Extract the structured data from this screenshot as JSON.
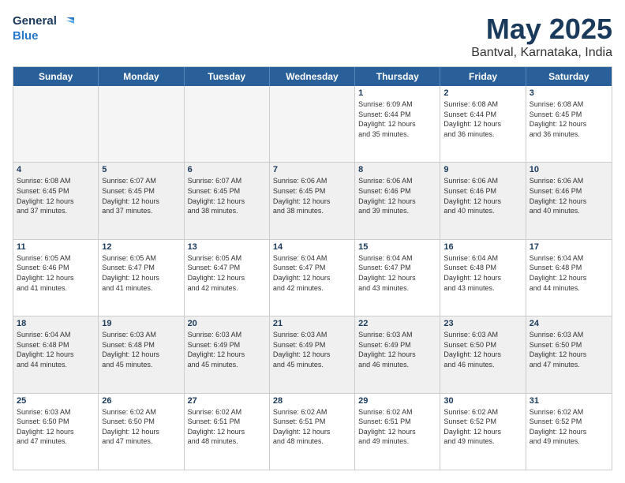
{
  "logo": {
    "line1": "General",
    "line2": "Blue"
  },
  "title": "May 2025",
  "subtitle": "Bantval, Karnataka, India",
  "header_days": [
    "Sunday",
    "Monday",
    "Tuesday",
    "Wednesday",
    "Thursday",
    "Friday",
    "Saturday"
  ],
  "rows": [
    [
      {
        "day": "",
        "info": "",
        "empty": true
      },
      {
        "day": "",
        "info": "",
        "empty": true
      },
      {
        "day": "",
        "info": "",
        "empty": true
      },
      {
        "day": "",
        "info": "",
        "empty": true
      },
      {
        "day": "1",
        "info": "Sunrise: 6:09 AM\nSunset: 6:44 PM\nDaylight: 12 hours\nand 35 minutes."
      },
      {
        "day": "2",
        "info": "Sunrise: 6:08 AM\nSunset: 6:44 PM\nDaylight: 12 hours\nand 36 minutes."
      },
      {
        "day": "3",
        "info": "Sunrise: 6:08 AM\nSunset: 6:45 PM\nDaylight: 12 hours\nand 36 minutes."
      }
    ],
    [
      {
        "day": "4",
        "info": "Sunrise: 6:08 AM\nSunset: 6:45 PM\nDaylight: 12 hours\nand 37 minutes."
      },
      {
        "day": "5",
        "info": "Sunrise: 6:07 AM\nSunset: 6:45 PM\nDaylight: 12 hours\nand 37 minutes."
      },
      {
        "day": "6",
        "info": "Sunrise: 6:07 AM\nSunset: 6:45 PM\nDaylight: 12 hours\nand 38 minutes."
      },
      {
        "day": "7",
        "info": "Sunrise: 6:06 AM\nSunset: 6:45 PM\nDaylight: 12 hours\nand 38 minutes."
      },
      {
        "day": "8",
        "info": "Sunrise: 6:06 AM\nSunset: 6:46 PM\nDaylight: 12 hours\nand 39 minutes."
      },
      {
        "day": "9",
        "info": "Sunrise: 6:06 AM\nSunset: 6:46 PM\nDaylight: 12 hours\nand 40 minutes."
      },
      {
        "day": "10",
        "info": "Sunrise: 6:06 AM\nSunset: 6:46 PM\nDaylight: 12 hours\nand 40 minutes."
      }
    ],
    [
      {
        "day": "11",
        "info": "Sunrise: 6:05 AM\nSunset: 6:46 PM\nDaylight: 12 hours\nand 41 minutes."
      },
      {
        "day": "12",
        "info": "Sunrise: 6:05 AM\nSunset: 6:47 PM\nDaylight: 12 hours\nand 41 minutes."
      },
      {
        "day": "13",
        "info": "Sunrise: 6:05 AM\nSunset: 6:47 PM\nDaylight: 12 hours\nand 42 minutes."
      },
      {
        "day": "14",
        "info": "Sunrise: 6:04 AM\nSunset: 6:47 PM\nDaylight: 12 hours\nand 42 minutes."
      },
      {
        "day": "15",
        "info": "Sunrise: 6:04 AM\nSunset: 6:47 PM\nDaylight: 12 hours\nand 43 minutes."
      },
      {
        "day": "16",
        "info": "Sunrise: 6:04 AM\nSunset: 6:48 PM\nDaylight: 12 hours\nand 43 minutes."
      },
      {
        "day": "17",
        "info": "Sunrise: 6:04 AM\nSunset: 6:48 PM\nDaylight: 12 hours\nand 44 minutes."
      }
    ],
    [
      {
        "day": "18",
        "info": "Sunrise: 6:04 AM\nSunset: 6:48 PM\nDaylight: 12 hours\nand 44 minutes."
      },
      {
        "day": "19",
        "info": "Sunrise: 6:03 AM\nSunset: 6:48 PM\nDaylight: 12 hours\nand 45 minutes."
      },
      {
        "day": "20",
        "info": "Sunrise: 6:03 AM\nSunset: 6:49 PM\nDaylight: 12 hours\nand 45 minutes."
      },
      {
        "day": "21",
        "info": "Sunrise: 6:03 AM\nSunset: 6:49 PM\nDaylight: 12 hours\nand 45 minutes."
      },
      {
        "day": "22",
        "info": "Sunrise: 6:03 AM\nSunset: 6:49 PM\nDaylight: 12 hours\nand 46 minutes."
      },
      {
        "day": "23",
        "info": "Sunrise: 6:03 AM\nSunset: 6:50 PM\nDaylight: 12 hours\nand 46 minutes."
      },
      {
        "day": "24",
        "info": "Sunrise: 6:03 AM\nSunset: 6:50 PM\nDaylight: 12 hours\nand 47 minutes."
      }
    ],
    [
      {
        "day": "25",
        "info": "Sunrise: 6:03 AM\nSunset: 6:50 PM\nDaylight: 12 hours\nand 47 minutes."
      },
      {
        "day": "26",
        "info": "Sunrise: 6:02 AM\nSunset: 6:50 PM\nDaylight: 12 hours\nand 47 minutes."
      },
      {
        "day": "27",
        "info": "Sunrise: 6:02 AM\nSunset: 6:51 PM\nDaylight: 12 hours\nand 48 minutes."
      },
      {
        "day": "28",
        "info": "Sunrise: 6:02 AM\nSunset: 6:51 PM\nDaylight: 12 hours\nand 48 minutes."
      },
      {
        "day": "29",
        "info": "Sunrise: 6:02 AM\nSunset: 6:51 PM\nDaylight: 12 hours\nand 49 minutes."
      },
      {
        "day": "30",
        "info": "Sunrise: 6:02 AM\nSunset: 6:52 PM\nDaylight: 12 hours\nand 49 minutes."
      },
      {
        "day": "31",
        "info": "Sunrise: 6:02 AM\nSunset: 6:52 PM\nDaylight: 12 hours\nand 49 minutes."
      }
    ]
  ]
}
